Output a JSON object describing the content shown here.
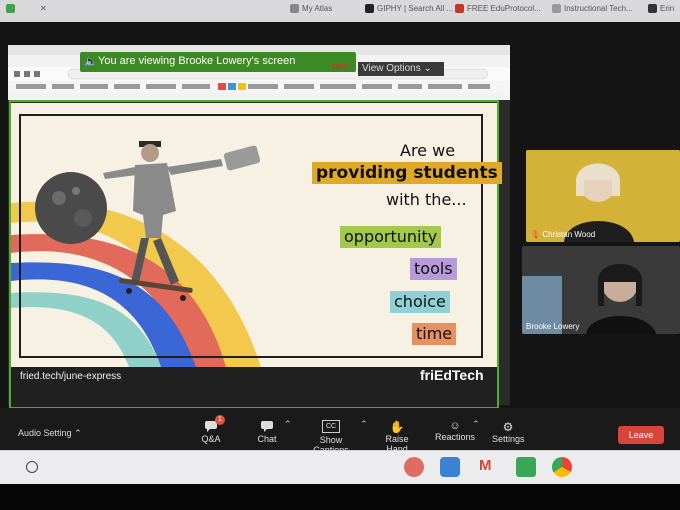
{
  "browser_tabs": [
    "My Atlas",
    "GIPHY | Search All ...",
    "FREE EduProtocol...",
    "Instructional Tech...",
    "Erin"
  ],
  "share_banner": {
    "text": "You are viewing Brooke Lowery's screen",
    "rec": "REC",
    "view_options": "View Options"
  },
  "slide": {
    "line1": "Are we",
    "line2": "providing students",
    "line3": "with the...",
    "words": [
      "opportunity",
      "tools",
      "choice",
      "time"
    ],
    "word_colors": [
      "#a3c94a",
      "#b79ad9",
      "#8fd0d6",
      "#e7915f"
    ],
    "url": "fried.tech/june-express",
    "logo": "friEdTech"
  },
  "participants": [
    {
      "name": "Christan Wood"
    },
    {
      "name": "Brooke Lowery"
    }
  ],
  "toolbar": {
    "audio_setting": "Audio Setting",
    "qa": "Q&A",
    "qa_badge": "1",
    "chat": "Chat",
    "captions": "Show Captions",
    "captions_icon": "CC",
    "raise_hand": "Raise Hand",
    "reactions": "Reactions",
    "settings": "Settings",
    "leave": "Leave"
  },
  "colors": {
    "share_green": "#3d8a24",
    "leave_red": "#d8453c"
  }
}
